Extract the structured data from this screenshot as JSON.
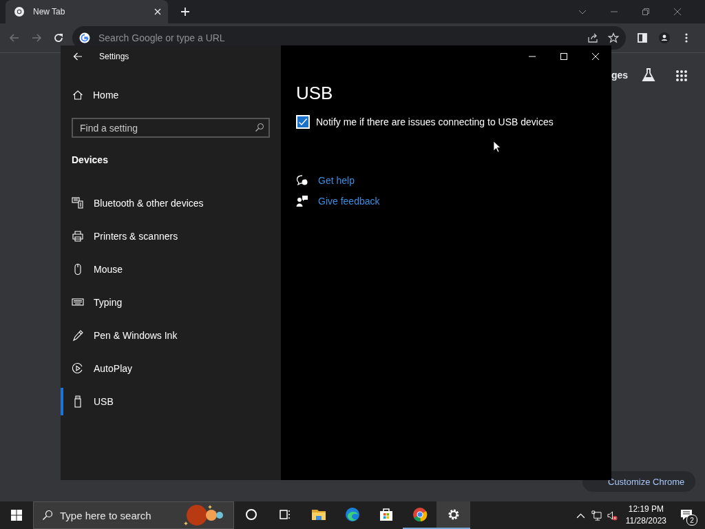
{
  "browser": {
    "tab": {
      "title": "New Tab",
      "selected": true
    },
    "omnibox": {
      "placeholder": "Search Google or type a URL"
    },
    "page": {
      "link_partial": "ges",
      "customize": "Customize Chrome"
    }
  },
  "settings": {
    "title": "Settings",
    "home": "Home",
    "search": {
      "placeholder": "Find a setting"
    },
    "section": "Devices",
    "items": [
      {
        "label": "Bluetooth & other devices",
        "selected": false
      },
      {
        "label": "Printers & scanners",
        "selected": false
      },
      {
        "label": "Mouse",
        "selected": false
      },
      {
        "label": "Typing",
        "selected": false
      },
      {
        "label": "Pen & Windows Ink",
        "selected": false
      },
      {
        "label": "AutoPlay",
        "selected": false
      },
      {
        "label": "USB",
        "selected": true
      }
    ],
    "page_title": "USB",
    "checkbox": {
      "label": "Notify me if there are issues connecting to USB devices",
      "checked": true
    },
    "links": [
      "Get help",
      "Give feedback"
    ]
  },
  "taskbar": {
    "search": {
      "placeholder": "Type here to search"
    },
    "apps": [
      {
        "kind": "cortana",
        "running": false,
        "selected": false
      },
      {
        "kind": "taskview",
        "running": false,
        "selected": false
      },
      {
        "kind": "explorer",
        "running": false,
        "selected": false
      },
      {
        "kind": "edge",
        "running": false,
        "selected": false
      },
      {
        "kind": "store",
        "running": false,
        "selected": false
      },
      {
        "kind": "chrome",
        "running": true,
        "selected": false
      },
      {
        "kind": "settings",
        "running": true,
        "selected": true
      }
    ],
    "time": "12:19 PM",
    "date": "11/28/2023",
    "notifications": "2"
  }
}
